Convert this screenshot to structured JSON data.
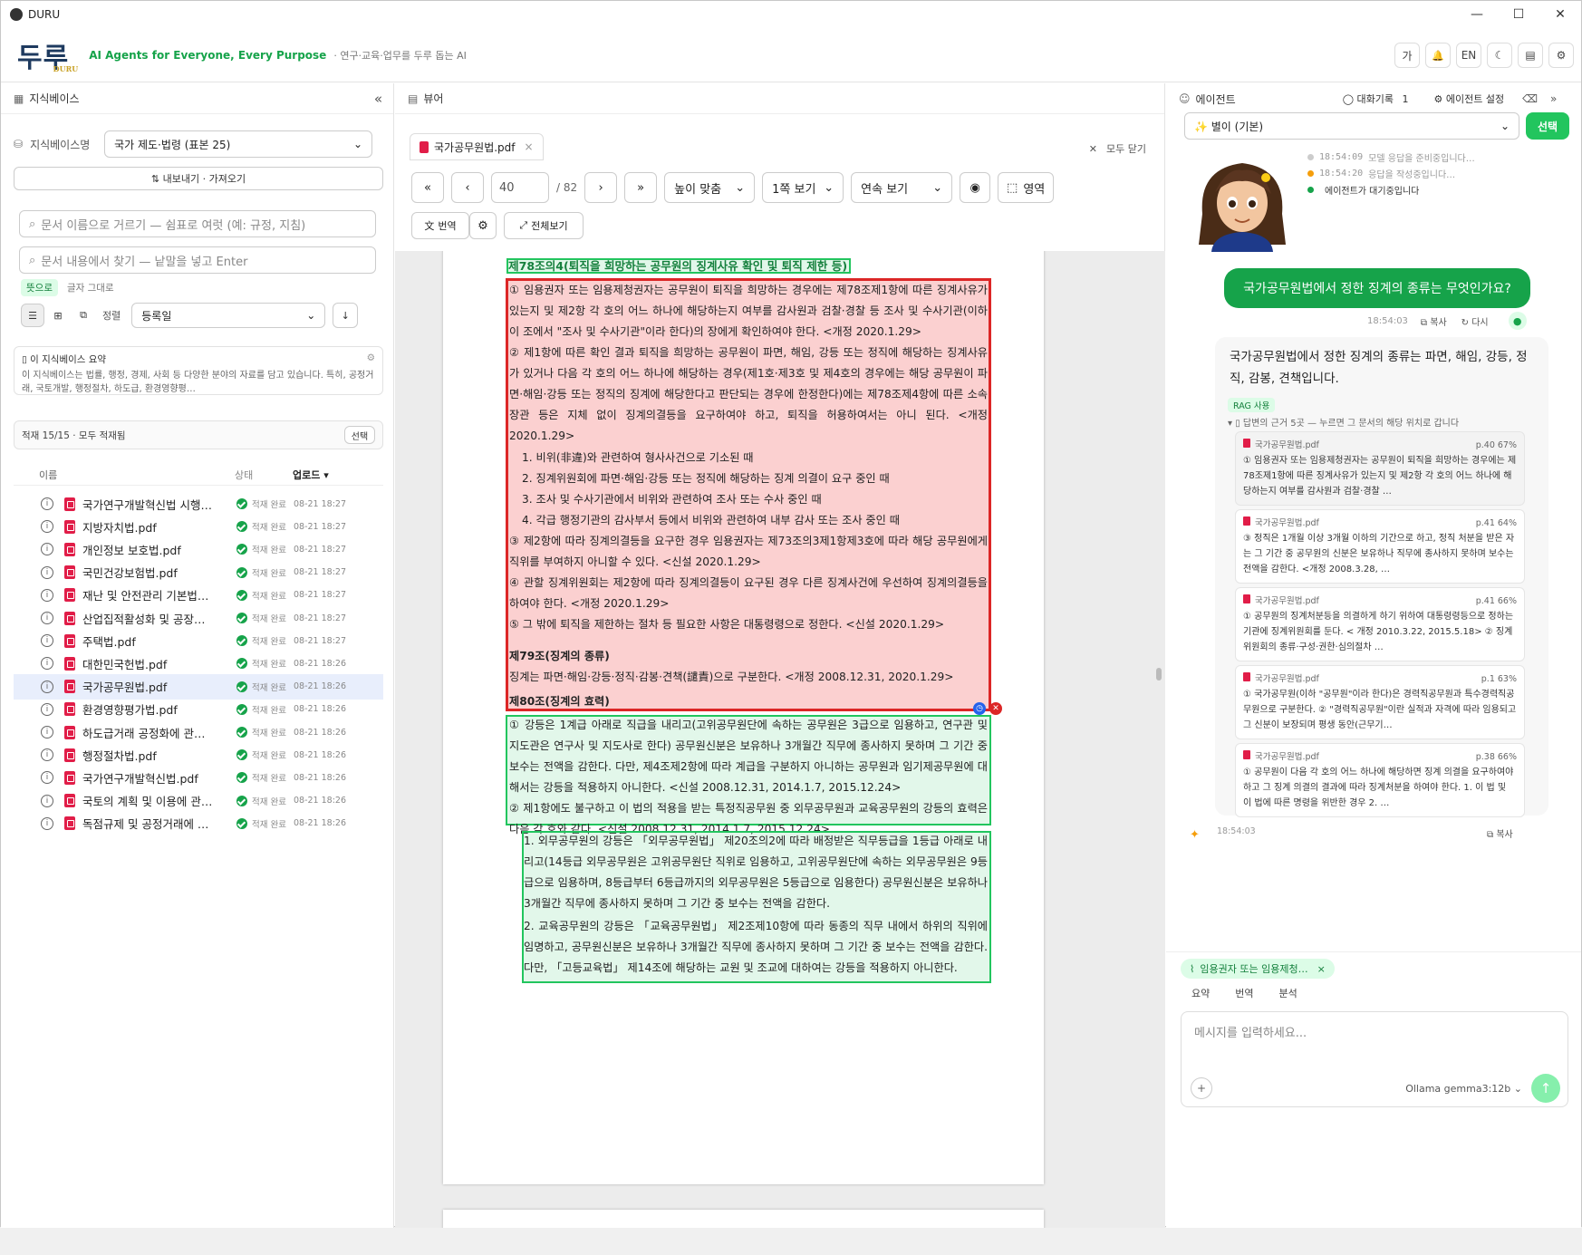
{
  "window": {
    "title": "DURU",
    "controls": [
      "—",
      "☐",
      "✕"
    ]
  },
  "header": {
    "brand": "두루",
    "brand_sub": "DURU",
    "tagline": "AI Agents for Everyone, Every Purpose",
    "subtag": "· 연구·교육·업무를 두루 돕는 AI",
    "icons": [
      "가",
      "🔔",
      "EN",
      "☾",
      "▤",
      "⚙"
    ]
  },
  "left": {
    "title": "지식베이스",
    "kb_label": "지식베이스명",
    "kb_value": "국가 제도·법령 (표본 25)",
    "export_import": "⇅  내보내기 · 가져오기",
    "filter_placeholder": "문서 이름으로 거르기 — 쉼표로 여럿 (예: 규정, 지침)",
    "search_placeholder": "문서 내용에서 찾기 — 낱말을 넣고 Enter",
    "mode_active": "뜻으로",
    "mode_other": "글자 그대로",
    "sort_label": "정렬",
    "sort_value": "등록일",
    "summary_title": "이 지식베이스 요약",
    "summary_text": "이 지식베이스는 법률, 행정, 경제, 사회 등 다양한 분야의 자료를 담고 있습니다. 특히, 공정거래, 국토개발, 행정절차, 하도급, 환경영향평…",
    "load_status": "적재 15/15 · 모두 적재됨",
    "select_btn": "선택",
    "cols": {
      "name": "이름",
      "status": "상태",
      "uploaded": "업로드 ▾"
    },
    "files": [
      {
        "name": "국가연구개발혁신법 시행…",
        "status": "적재 완료",
        "time": "08-21 18:27"
      },
      {
        "name": "지방자치법.pdf",
        "status": "적재 완료",
        "time": "08-21 18:27"
      },
      {
        "name": "개인정보 보호법.pdf",
        "status": "적재 완료",
        "time": "08-21 18:27"
      },
      {
        "name": "국민건강보험법.pdf",
        "status": "적재 완료",
        "time": "08-21 18:27"
      },
      {
        "name": "재난 및 안전관리 기본법…",
        "status": "적재 완료",
        "time": "08-21 18:27"
      },
      {
        "name": "산업집적활성화 및 공장…",
        "status": "적재 완료",
        "time": "08-21 18:27"
      },
      {
        "name": "주택법.pdf",
        "status": "적재 완료",
        "time": "08-21 18:27"
      },
      {
        "name": "대한민국헌법.pdf",
        "status": "적재 완료",
        "time": "08-21 18:26"
      },
      {
        "name": "국가공무원법.pdf",
        "status": "적재 완료",
        "time": "08-21 18:26"
      },
      {
        "name": "환경영향평가법.pdf",
        "status": "적재 완료",
        "time": "08-21 18:26"
      },
      {
        "name": "하도급거래 공정화에 관…",
        "status": "적재 완료",
        "time": "08-21 18:26"
      },
      {
        "name": "행정절차법.pdf",
        "status": "적재 완료",
        "time": "08-21 18:26"
      },
      {
        "name": "국가연구개발혁신법.pdf",
        "status": "적재 완료",
        "time": "08-21 18:26"
      },
      {
        "name": "국토의 계획 및 이용에 관…",
        "status": "적재 완료",
        "time": "08-21 18:26"
      },
      {
        "name": "독점규제 및 공정거래에 …",
        "status": "적재 완료",
        "time": "08-21 18:26"
      }
    ]
  },
  "viewer": {
    "title": "뷰어",
    "tab": "국가공무원법.pdf",
    "close_all": "모두 닫기",
    "page_value": "40",
    "page_total": "/ 82",
    "zoom": "높이 맞춤",
    "layout": "1쪽 보기",
    "scroll": "연속 보기",
    "area": "영역",
    "translate": "번역",
    "fullscreen": "전체보기",
    "doc": {
      "h1": "제78조의4(퇴직을 희망하는 공무원의 징계사유 확인 및 퇴직 제한 등)",
      "p1": "① 임용권자 또는 임용제청권자는 공무원이 퇴직을 희망하는 경우에는 제78조제1항에 따른 징계사유가 있는지 및 제2항 각 호의 어느 하나에 해당하는지 여부를 감사원과 검찰·경찰 등 조사 및 수사기관(이하 이 조에서 \"조사 및 수사기관\"이라 한다)의 장에게 확인하여야 한다. <개정 2020.1.29>",
      "p2": "② 제1항에 따른 확인 결과 퇴직을 희망하는 공무원이 파면, 해임, 강등 또는 정직에 해당하는 징계사유가 있거나 다음 각 호의 어느 하나에 해당하는 경우(제1호·제3호 및 제4호의 경우에는 해당 공무원이 파면·해임·강등 또는 정직의 징계에 해당한다고 판단되는 경우에 한정한다)에는 제78조제4항에 따른 소속 장관 등은 지체 없이 징계의결등을 요구하여야 하고, 퇴직을 허용하여서는 아니 된다. <개정 2020.1.29>",
      "items": [
        "1. 비위(非違)와 관련하여 형사사건으로 기소된 때",
        "2. 징계위원회에 파면·해임·강등 또는 정직에 해당하는 징계 의결이 요구 중인 때",
        "3. 조사 및 수사기관에서 비위와 관련하여 조사 또는 수사 중인 때",
        "4. 각급 행정기관의 감사부서 등에서 비위와 관련하여 내부 감사 또는 조사 중인 때"
      ],
      "p3": "③ 제2항에 따라 징계의결등을 요구한 경우 임용권자는 제73조의3제1항제3호에 따라 해당 공무원에게 직위를 부여하지 아니할 수 있다. <신설 2020.1.29>",
      "p4": "④ 관할 징계위원회는 제2항에 따라 징계의결등이 요구된 경우 다른 징계사건에 우선하여 징계의결등을 하여야 한다. <개정 2020.1.29>",
      "p5": "⑤ 그 밖에 퇴직을 제한하는 절차 등 필요한 사항은 대통령령으로 정한다. <신설 2020.1.29>",
      "h2": "제79조(징계의 종류)",
      "p6": "징계는 파면·해임·강등·정직·감봉·견책(譴責)으로 구분한다. <개정 2008.12.31, 2020.1.29>",
      "h3": "제80조(징계의 효력)",
      "p7": "① 강등은 1계급 아래로 직급을 내리고(고위공무원단에 속하는 공무원은 3급으로 임용하고, 연구관 및 지도관은 연구사 및 지도사로 한다) 공무원신분은 보유하나 3개월간 직무에 종사하지 못하며 그 기간 중 보수는 전액을 감한다. 다만, 제4조제2항에 따라 계급을 구분하지 아니하는 공무원과 임기제공무원에 대해서는 강등을 적용하지 아니한다. <신설 2008.12.31, 2014.1.7, 2015.12.24>",
      "p8": "② 제1항에도 불구하고 이 법의 적용을 받는 특정직공무원 중 외무공무원과 교육공무원의 강등의 효력은 다음 각 호와 같다. <신설 2008.12.31, 2014.1.7, 2015.12.24>",
      "p9": "1. 외무공무원의 강등은 「외무공무원법」 제20조의2에 따라 배정받은 직무등급을 1등급 아래로 내리고(14등급 외무공무원은 고위공무원단 직위로 임용하고, 고위공무원단에 속하는 외무공무원은 9등급으로 임용하며, 8등급부터 6등급까지의 외무공무원은 5등급으로 임용한다) 공무원신분은 보유하나 3개월간 직무에 종사하지 못하며 그 기간 중 보수는 전액을 감한다.",
      "p10": "2. 교육공무원의 강등은 「교육공무원법」 제2조제10항에 따라 동종의 직무 내에서 하위의 직위에 임명하고, 공무원신분은 보유하나 3개월간 직무에 종사하지 못하며 그 기간 중 보수는 전액을 감한다. 다만, 「고등교육법」 제14조에 해당하는 교원 및 조교에 대하여는 강등을 적용하지 아니한다."
    }
  },
  "agent": {
    "title": "에이전트",
    "history": "대화기록",
    "history_count": "1",
    "settings": "에이전트 설정",
    "persona": "✨ 별이 (기본)",
    "select_btn": "선택",
    "logs": [
      {
        "time": "18:54:09",
        "text": "모델 응답을 준비중입니다…",
        "color": "#cccccc"
      },
      {
        "time": "18:54:20",
        "text": "응답을 작성중입니다…",
        "color": "#f59e0b"
      },
      {
        "time": "",
        "text": "에이전트가 대기중입니다",
        "color": "#16a34a"
      }
    ],
    "user_msg": "국가공무원법에서 정한 징계의 종류는 무엇인가요?",
    "user_time": "18:54:03",
    "copy": "복사",
    "retry": "다시",
    "answer": "국가공무원법에서 정한 징계의 종류는 파면, 해임, 강등, 정직, 감봉, 견책입니다.",
    "rag_badge": "RAG 사용",
    "sources_title": "답변의 근거 5곳 — 누르면 그 문서의 해당 위치로 갑니다",
    "sources": [
      {
        "file": "국가공무원법.pdf",
        "meta": "p.40  67%",
        "text": "① 임용권자 또는 임용제청권자는 공무원이 퇴직을 희망하는 경우에는 제78조제1항에 따른 징계사유가 있는지 및 제2항 각 호의 어느 하나에 해당하는지 여부를 감사원과 검찰·경찰 …"
      },
      {
        "file": "국가공무원법.pdf",
        "meta": "p.41  64%",
        "text": "③ 정직은 1개월 이상 3개월 이하의 기간으로 하고, 정직 처분을 받은 자는 그 기간 중 공무원의 신분은 보유하나 직무에 종사하지 못하며 보수는 전액을 감한다. <개정 2008.3.28, …"
      },
      {
        "file": "국가공무원법.pdf",
        "meta": "p.41  66%",
        "text": "① 공무원의 징계처분등을 의결하게 하기 위하여 대통령령등으로 정하는 기관에 징계위원회를 둔다. < 개정 2010.3.22, 2015.5.18> ② 징계위원회의 종류·구성·권한·심의절차 …"
      },
      {
        "file": "국가공무원법.pdf",
        "meta": "p.1  63%",
        "text": "① 국가공무원(이하 \"공무원\"이라 한다)은 경력직공무원과 특수경력직공무원으로 구분한다. ② \"경력직공무원\"이란 실적과 자격에 따라 임용되고 그 신분이 보장되며 평생 동안(근무기…"
      },
      {
        "file": "국가공무원법.pdf",
        "meta": "p.38  66%",
        "text": "① 공무원이 다음 각 호의 어느 하나에 해당하면 징계 의결을 요구하여야 하고 그 징계 의결의 결과에 따라 징계처분을 하여야 한다. 1. 이 법 및 이 법에 따른 명령을 위반한 경우 2. …"
      }
    ],
    "ans_time": "18:54:03",
    "chip": "임용권자 또는 임용제청…",
    "quick": [
      "요약",
      "번역",
      "분석"
    ],
    "input_placeholder": "메시지를 입력하세요...",
    "model": "Ollama gemma3:12b"
  }
}
